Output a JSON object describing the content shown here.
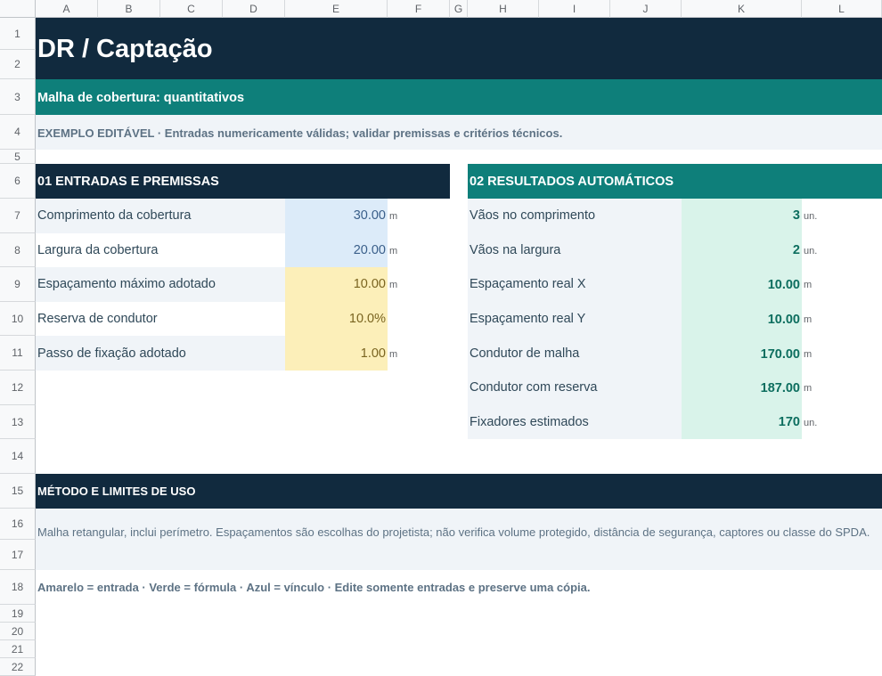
{
  "columns": [
    "A",
    "B",
    "C",
    "D",
    "E",
    "F",
    "G",
    "H",
    "I",
    "J",
    "K",
    "L"
  ],
  "rows": [
    "1",
    "2",
    "3",
    "4",
    "5",
    "6",
    "7",
    "8",
    "9",
    "10",
    "11",
    "12",
    "13",
    "14",
    "15",
    "16",
    "17",
    "18",
    "19",
    "20",
    "21",
    "22"
  ],
  "colors": {
    "navy": "#112a3e",
    "teal": "#0e7f7a",
    "input_blue": "#dcebf9",
    "input_yellow": "#fcefb9",
    "result_green": "#d9f3ea",
    "light_row": "#f0f4f8"
  },
  "header": {
    "title": "DR  /  Captação",
    "subtitle": "Malha de cobertura: quantitativos",
    "note": "EXEMPLO EDITÁVEL · Entradas numericamente válidas; validar premissas e critérios técnicos."
  },
  "inputs": {
    "title": "01  ENTRADAS E PREMISSAS",
    "items": [
      {
        "label": "Comprimento da cobertura",
        "value": "30.00",
        "unit": "m"
      },
      {
        "label": "Largura da cobertura",
        "value": "20.00",
        "unit": "m"
      },
      {
        "label": "Espaçamento máximo adotado",
        "value": "10.00",
        "unit": "m"
      },
      {
        "label": "Reserva de condutor",
        "value": "10.0%",
        "unit": ""
      },
      {
        "label": "Passo de fixação adotado",
        "value": "1.00",
        "unit": "m"
      }
    ]
  },
  "results": {
    "title": "02  RESULTADOS AUTOMÁTICOS",
    "items": [
      {
        "label": "Vãos no comprimento",
        "value": "3",
        "unit": "un."
      },
      {
        "label": "Vãos na largura",
        "value": "2",
        "unit": "un."
      },
      {
        "label": "Espaçamento real X",
        "value": "10.00",
        "unit": "m"
      },
      {
        "label": "Espaçamento real Y",
        "value": "10.00",
        "unit": "m"
      },
      {
        "label": "Condutor de malha",
        "value": "170.00",
        "unit": "m"
      },
      {
        "label": "Condutor com reserva",
        "value": "187.00",
        "unit": "m"
      },
      {
        "label": "Fixadores estimados",
        "value": "170",
        "unit": "un."
      }
    ]
  },
  "method": {
    "title": "MÉTODO E LIMITES DE USO",
    "text": "Malha retangular, inclui perímetro. Espaçamentos são escolhas do projetista; não verifica volume protegido, distância de segurança, captores ou classe do SPDA."
  },
  "legend": "Amarelo = entrada · Verde = fórmula · Azul = vínculo · Edite somente entradas e preserve uma cópia."
}
